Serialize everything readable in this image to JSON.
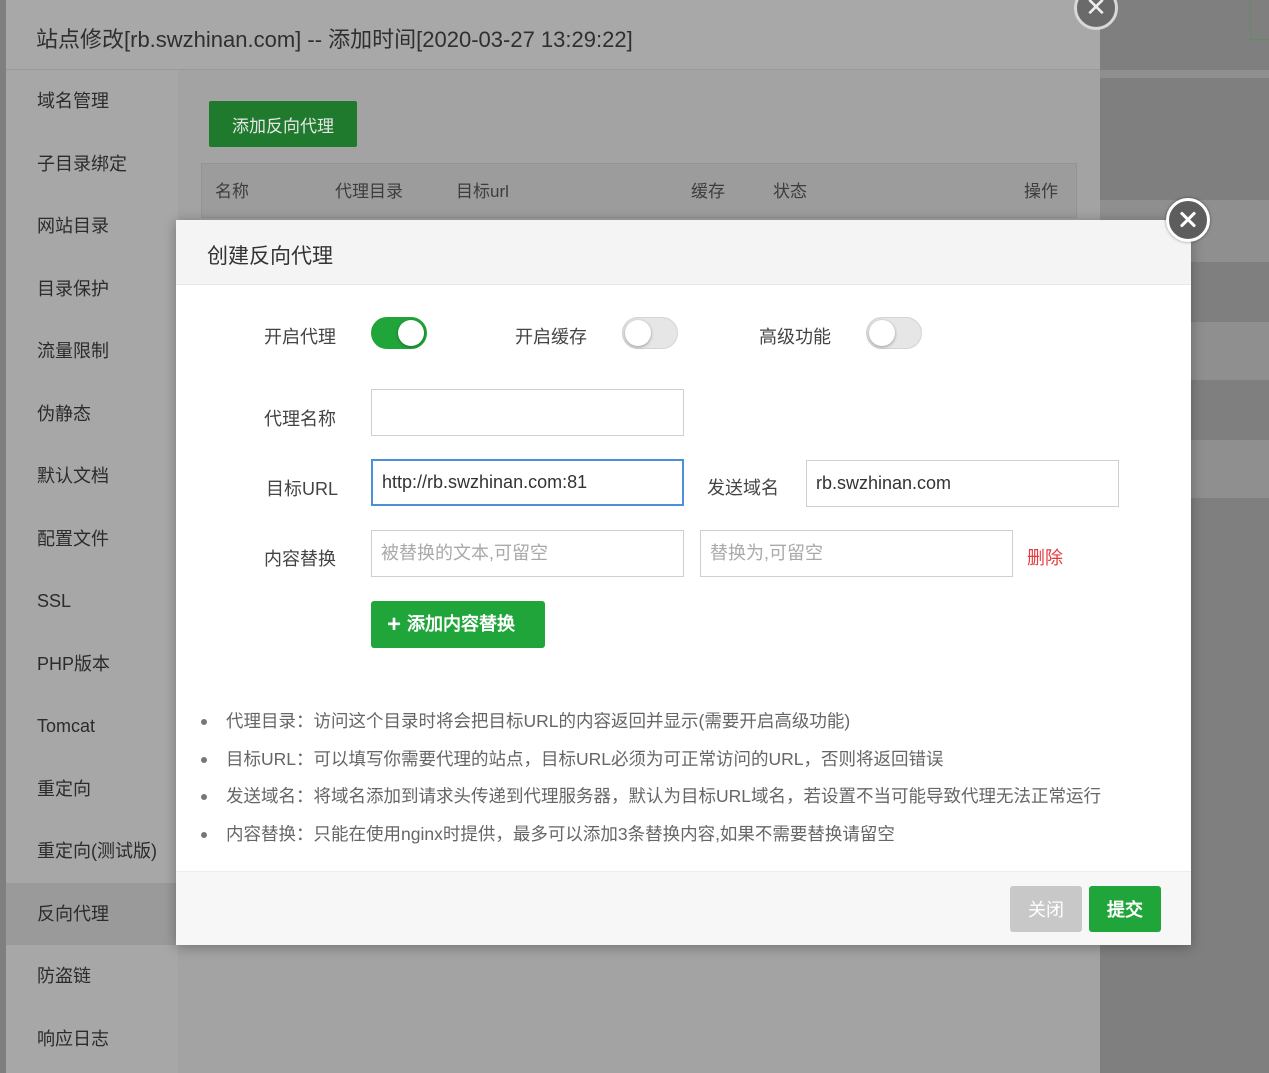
{
  "outer": {
    "title": "站点修改[rb.swzhinan.com] -- 添加时间[2020-03-27 13:29:22]",
    "close_glyph": "✕",
    "sidebar": [
      "域名管理",
      "子目录绑定",
      "网站目录",
      "目录保护",
      "流量限制",
      "伪静态",
      "默认文档",
      "配置文件",
      "SSL",
      "PHP版本",
      "Tomcat",
      "重定向",
      "重定向(测试版)",
      "反向代理",
      "防盗链",
      "响应日志"
    ],
    "active_item": "反向代理",
    "add_button": "添加反向代理",
    "table_headers": [
      "名称",
      "代理目录",
      "目标url",
      "缓存",
      "状态",
      "操作"
    ]
  },
  "modal": {
    "title": "创建反向代理",
    "toggles": {
      "proxy": {
        "label": "开启代理",
        "on": true
      },
      "cache": {
        "label": "开启缓存",
        "on": false
      },
      "advanced": {
        "label": "高级功能",
        "on": false
      }
    },
    "proxy_name": {
      "label": "代理名称",
      "value": ""
    },
    "target_url": {
      "label": "目标URL",
      "value": "http://rb.swzhinan.com:81"
    },
    "send_domain": {
      "label": "发送域名",
      "value": "rb.swzhinan.com"
    },
    "content_replace": {
      "label": "内容替换",
      "find_placeholder": "被替换的文本,可留空",
      "replace_placeholder": "替换为,可留空",
      "delete_label": "删除"
    },
    "add_content_button": "添加内容替换",
    "tips": [
      "代理目录：访问这个目录时将会把目标URL的内容返回并显示(需要开启高级功能)",
      "目标URL：可以填写你需要代理的站点，目标URL必须为可正常访问的URL，否则将返回错误",
      "发送域名：将域名添加到请求头传递到代理服务器，默认为目标URL域名，若设置不当可能导致代理无法正常运行",
      "内容替换：只能在使用nginx时提供，最多可以添加3条替换内容,如果不需要替换请留空"
    ],
    "footer": {
      "close_label": "关闭",
      "submit_label": "提交"
    }
  },
  "colors": {
    "accent": "#20a53a",
    "focus": "#4b90d9",
    "danger": "#e4393c"
  }
}
